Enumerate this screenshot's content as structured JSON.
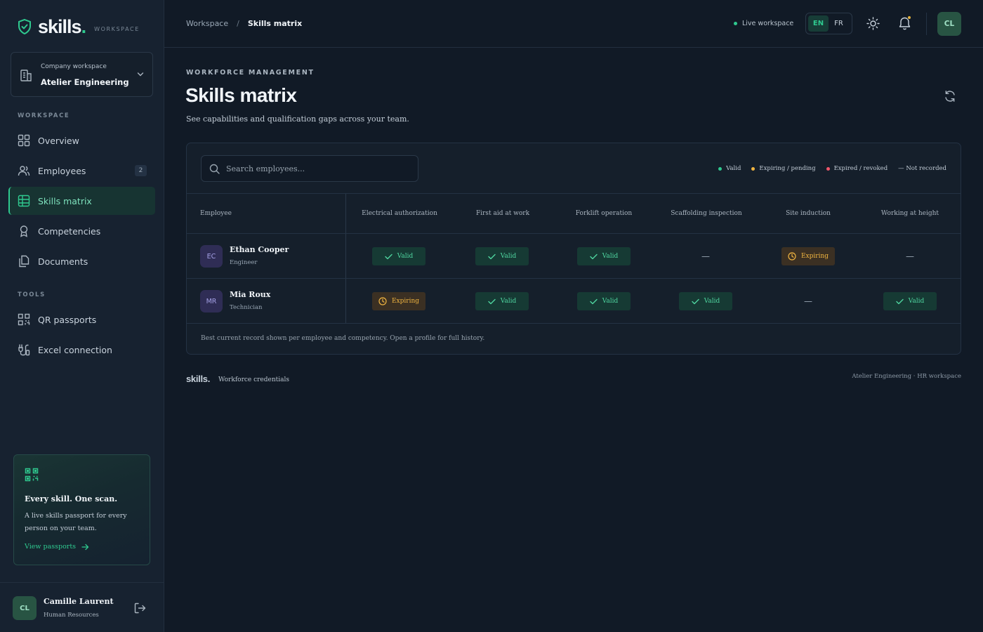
{
  "brand": {
    "name": "skills",
    "dot": ".",
    "tag": "WORKSPACE"
  },
  "workspace": {
    "label": "Company workspace",
    "name": "Atelier Engineering"
  },
  "sidebar": {
    "section_workspace": "WORKSPACE",
    "items": [
      {
        "label": "Overview",
        "icon": "grid-icon"
      },
      {
        "label": "Employees",
        "icon": "users-icon",
        "badge": "2"
      },
      {
        "label": "Skills matrix",
        "icon": "table-icon",
        "active": true
      },
      {
        "label": "Competencies",
        "icon": "award-icon"
      },
      {
        "label": "Documents",
        "icon": "documents-icon"
      }
    ],
    "section_tools": "TOOLS",
    "tools": [
      {
        "label": "QR passports",
        "icon": "qr-icon"
      },
      {
        "label": "Excel connection",
        "icon": "connection-icon"
      }
    ]
  },
  "promo": {
    "title": "Every skill. One scan.",
    "text": "A live skills passport for every person on your team.",
    "link": "View passports"
  },
  "user": {
    "initials": "CL",
    "name": "Camille Laurent",
    "role": "Human Resources"
  },
  "topbar": {
    "breadcrumb": [
      "Workspace",
      "/",
      "Skills matrix"
    ],
    "live": "Live workspace",
    "langs": [
      "EN",
      "FR"
    ],
    "avatar": "CL"
  },
  "page": {
    "eyebrow": "WORKFORCE MANAGEMENT",
    "title": "Skills matrix",
    "subtitle": "See capabilities and qualification gaps across your team."
  },
  "search": {
    "placeholder": "Search employees..."
  },
  "legend": [
    {
      "label": "Valid",
      "color": "#2fc98f"
    },
    {
      "label": "Expiring / pending",
      "color": "#f0b440"
    },
    {
      "label": "Expired / revoked",
      "color": "#f0566a"
    },
    {
      "label": "— Not recorded",
      "color": ""
    }
  ],
  "table": {
    "employee_header": "Employee",
    "columns": [
      "Electrical authorization",
      "First aid at work",
      "Forklift operation",
      "Scaffolding inspection",
      "Site induction",
      "Working at height"
    ],
    "rows": [
      {
        "initials": "EC",
        "name": "Ethan Cooper",
        "role": "Engineer",
        "cells": [
          "Valid",
          "Valid",
          "Valid",
          "—",
          "Expiring",
          "—"
        ]
      },
      {
        "initials": "MR",
        "name": "Mia Roux",
        "role": "Technician",
        "cells": [
          "Expiring",
          "Valid",
          "Valid",
          "Valid",
          "—",
          "Valid"
        ]
      }
    ],
    "footnote": "Best current record shown per employee and competency. Open a profile for full history."
  },
  "footer": {
    "brand": "skills.",
    "tag": "Workforce credentials",
    "right": "Atelier Engineering · HR workspace"
  },
  "colors": {
    "accent": "#2fc98f",
    "warning": "#f0b440",
    "danger": "#f0566a",
    "background": "#111a26"
  }
}
